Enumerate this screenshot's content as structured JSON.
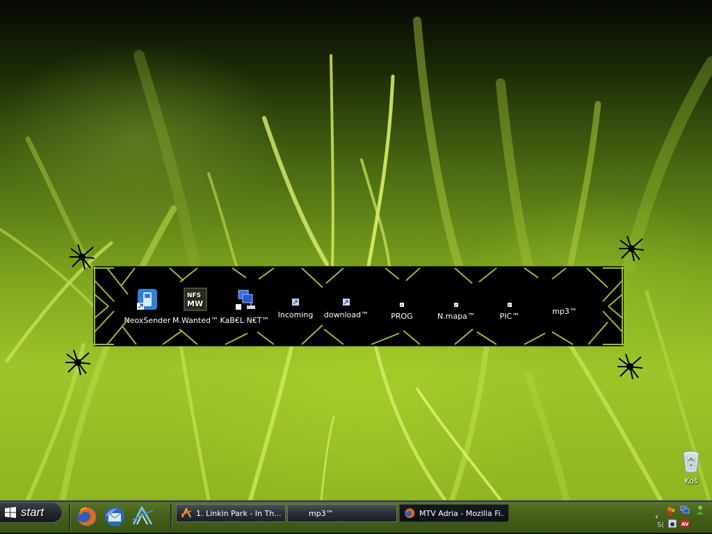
{
  "desktop": {
    "dock_items": [
      {
        "label": "NeoxSender",
        "icon": "phone-app-icon"
      },
      {
        "label": "M.Wanted™",
        "icon": "nfs-game-icon"
      },
      {
        "label": "KaB€L N€T™",
        "icon": "network-connections-icon"
      },
      {
        "label": "Incoming",
        "icon": "folder-shortcut-icon"
      },
      {
        "label": "download™",
        "icon": "folder-shortcut-icon"
      },
      {
        "label": "PROG",
        "icon": "folder-shortcut-icon"
      },
      {
        "label": "N.mapa™",
        "icon": "folder-shortcut-icon"
      },
      {
        "label": "PIC™",
        "icon": "folder-shortcut-icon"
      },
      {
        "label": "mp3™",
        "icon": "folder-icon"
      }
    ],
    "recycle_bin": {
      "label": "Koš",
      "icon": "recycle-bin-icon"
    },
    "colors": {
      "accent_green": "#9ec52a",
      "dock_frame": "#b5cf30"
    }
  },
  "taskbar": {
    "start_label": "start",
    "quick_launch": [
      "firefox-icon",
      "thunderbird-icon",
      "winamp-icon"
    ],
    "tasks": [
      {
        "label": "1. Linkin Park - In Th...",
        "icon": "winamp-icon",
        "active": false
      },
      {
        "label": "mp3™",
        "icon": "folder-icon",
        "active": false
      },
      {
        "label": "MTV Adria - Mozilla Fi...",
        "icon": "firefox-icon",
        "active": true
      }
    ],
    "tray": {
      "clock_partial": "S(",
      "icons": [
        "messenger-icon",
        "network-icon",
        "user-icon",
        "volume-icon",
        "antivirus-icon"
      ]
    }
  }
}
